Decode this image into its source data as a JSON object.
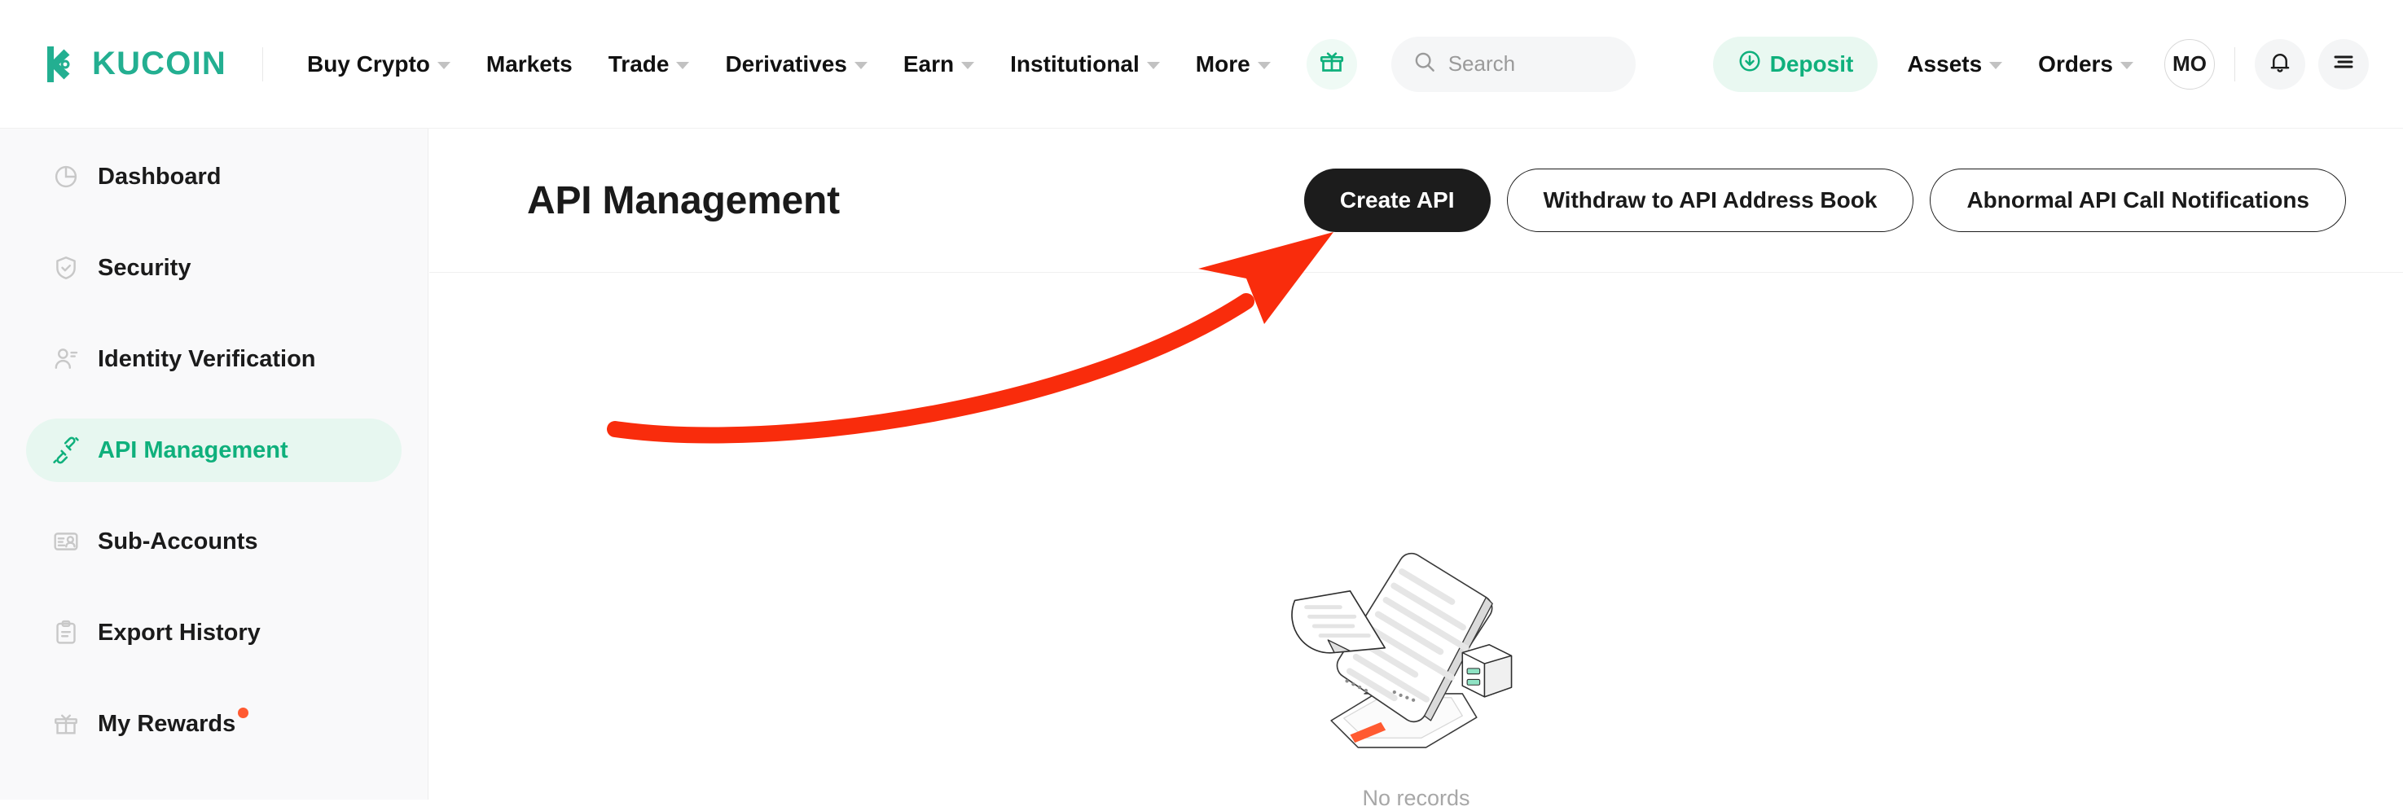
{
  "brand": {
    "name": "KUCOIN",
    "logo_icon": "kucoin-k-logo",
    "accent_green": "#23af91",
    "deposit_green": "#0fb07c",
    "active_pill_bg": "#e7f7f0",
    "badge_red": "#ff5a31",
    "annotation_red": "#f92c0c"
  },
  "topnav": {
    "items": [
      {
        "label": "Buy Crypto",
        "has_caret": true
      },
      {
        "label": "Markets",
        "has_caret": false
      },
      {
        "label": "Trade",
        "has_caret": true
      },
      {
        "label": "Derivatives",
        "has_caret": true
      },
      {
        "label": "Earn",
        "has_caret": true
      },
      {
        "label": "Institutional",
        "has_caret": true
      },
      {
        "label": "More",
        "has_caret": true
      }
    ],
    "gift_icon": "gift-icon",
    "search": {
      "placeholder": "Search",
      "icon": "search-icon"
    },
    "deposit": {
      "label": "Deposit",
      "icon": "download-arrow-icon"
    },
    "assets": {
      "label": "Assets",
      "has_caret": true
    },
    "orders": {
      "label": "Orders",
      "has_caret": true
    },
    "avatar": {
      "initials": "MO"
    },
    "notifications_icon": "bell-icon",
    "menu_icon": "hamburger-menu-icon"
  },
  "sidebar": {
    "items": [
      {
        "label": "Dashboard",
        "icon": "pie-chart-icon",
        "active": false,
        "badge": false
      },
      {
        "label": "Security",
        "icon": "shield-check-icon",
        "active": false,
        "badge": false
      },
      {
        "label": "Identity Verification",
        "icon": "user-id-icon",
        "active": false,
        "badge": false
      },
      {
        "label": "API Management",
        "icon": "api-plug-icon",
        "active": true,
        "badge": false
      },
      {
        "label": "Sub-Accounts",
        "icon": "sub-accounts-card-icon",
        "active": false,
        "badge": false
      },
      {
        "label": "Export History",
        "icon": "clipboard-icon",
        "active": false,
        "badge": false
      },
      {
        "label": "My Rewards",
        "icon": "gift-box-icon",
        "active": false,
        "badge": true
      }
    ]
  },
  "main": {
    "title": "API Management",
    "buttons": [
      {
        "label": "Create API",
        "style": "primary"
      },
      {
        "label": "Withdraw to API Address Book",
        "style": "outline"
      },
      {
        "label": "Abnormal API Call Notifications",
        "style": "outline"
      }
    ],
    "empty_state": {
      "illustration": "no-records-tablet-documents-illustration",
      "text": "No records"
    }
  },
  "annotation": {
    "type": "curved-arrow",
    "color": "#f92c0c",
    "points_to": "Create API"
  }
}
